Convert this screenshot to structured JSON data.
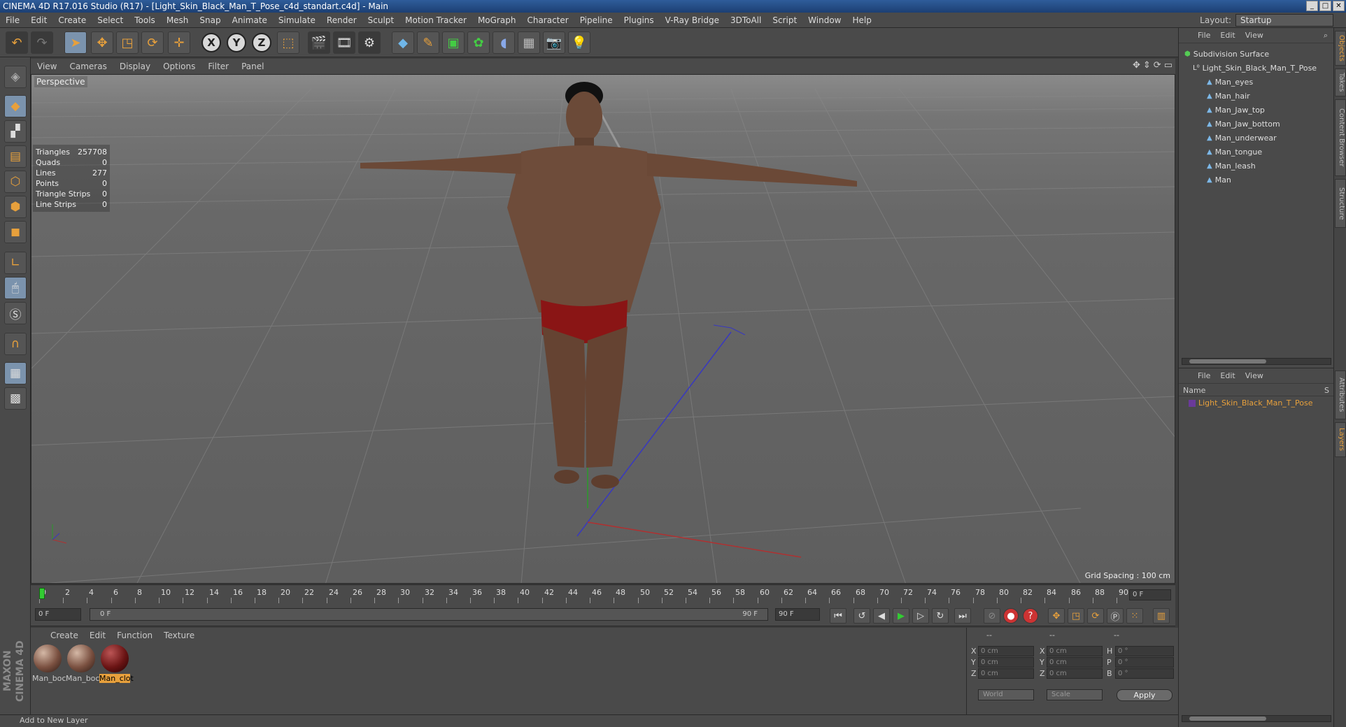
{
  "window": {
    "title": "CINEMA 4D R17.016 Studio (R17) - [Light_Skin_Black_Man_T_Pose_c4d_standart.c4d] - Main"
  },
  "menu": [
    "File",
    "Edit",
    "Create",
    "Select",
    "Tools",
    "Mesh",
    "Snap",
    "Animate",
    "Simulate",
    "Render",
    "Sculpt",
    "Motion Tracker",
    "MoGraph",
    "Character",
    "Pipeline",
    "Plugins",
    "V-Ray Bridge",
    "3DToAll",
    "Script",
    "Window",
    "Help"
  ],
  "layout": {
    "label": "Layout:",
    "value": "Startup"
  },
  "viewport": {
    "menu": [
      "View",
      "Cameras",
      "Display",
      "Options",
      "Filter",
      "Panel"
    ],
    "label": "Perspective",
    "stats": [
      {
        "k": "Triangles",
        "v": "257708"
      },
      {
        "k": "Quads",
        "v": "0"
      },
      {
        "k": "Lines",
        "v": "277"
      },
      {
        "k": "Points",
        "v": "0"
      },
      {
        "k": "Triangle Strips",
        "v": "0"
      },
      {
        "k": "Line Strips",
        "v": "0"
      }
    ],
    "grid_spacing": "Grid Spacing : 100 cm"
  },
  "timeline": {
    "ticks": [
      "0",
      "2",
      "4",
      "6",
      "8",
      "10",
      "12",
      "14",
      "16",
      "18",
      "20",
      "22",
      "24",
      "26",
      "28",
      "30",
      "32",
      "34",
      "36",
      "38",
      "40",
      "42",
      "44",
      "46",
      "48",
      "50",
      "52",
      "54",
      "56",
      "58",
      "60",
      "62",
      "64",
      "66",
      "68",
      "70",
      "72",
      "74",
      "76",
      "78",
      "80",
      "82",
      "84",
      "86",
      "88",
      "90"
    ],
    "frame_end": "0 F"
  },
  "transport": {
    "current": "0 F",
    "range_start": "0 F",
    "range_end": "90 F",
    "max": "90 F"
  },
  "materials": {
    "menu": [
      "Create",
      "Edit",
      "Function",
      "Texture"
    ],
    "items": [
      "Man_boc",
      "Man_boc",
      "Man_clot"
    ]
  },
  "coords": {
    "headers": [
      "--",
      "--",
      "--"
    ],
    "rows": [
      {
        "a": "X",
        "av": "0 cm",
        "b": "X",
        "bv": "0 cm",
        "c": "H",
        "cv": "0 °"
      },
      {
        "a": "Y",
        "av": "0 cm",
        "b": "Y",
        "bv": "0 cm",
        "c": "P",
        "cv": "0 °"
      },
      {
        "a": "Z",
        "av": "0 cm",
        "b": "Z",
        "bv": "0 cm",
        "c": "B",
        "cv": "0 °"
      }
    ],
    "space": "World",
    "mode": "Scale",
    "apply": "Apply"
  },
  "status": "Add to New Layer",
  "objects": {
    "menu": [
      "File",
      "Edit",
      "View"
    ],
    "items": [
      "Subdivision Surface",
      "Light_Skin_Black_Man_T_Pose",
      "Man_eyes",
      "Man_hair",
      "Man_Jaw_top",
      "Man_Jaw_bottom",
      "Man_underwear",
      "Man_tongue",
      "Man_leash",
      "Man"
    ]
  },
  "layers": {
    "menu": [
      "File",
      "Edit",
      "View"
    ],
    "col_name": "Name",
    "col_s": "S",
    "item": "Light_Skin_Black_Man_T_Pose"
  },
  "sidetabs": [
    "Objects",
    "Takes",
    "Content Browser",
    "Structure",
    "Attributes",
    "Layers"
  ],
  "colors": {
    "accent": "#e7a03c",
    "layer_text": "#e7a03c"
  }
}
